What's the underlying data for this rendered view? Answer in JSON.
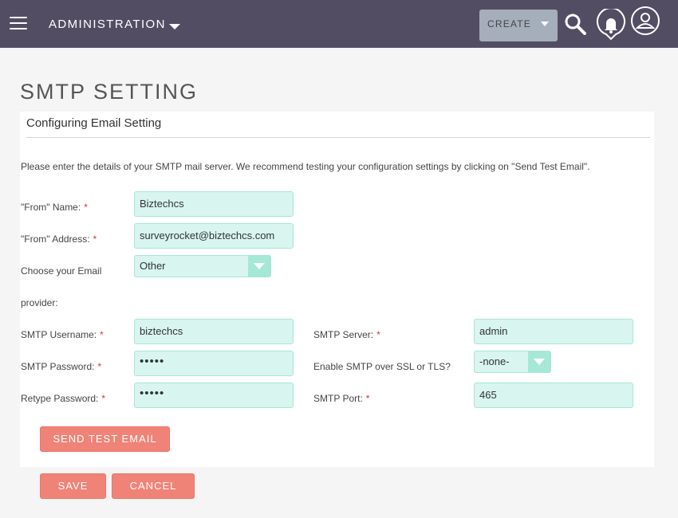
{
  "topbar": {
    "menu_label": "ADMINISTRATION",
    "create_label": "CREATE",
    "icons": [
      "menu-icon",
      "chevron-down-icon",
      "search-icon",
      "bell-icon",
      "user-icon"
    ],
    "colors": {
      "bar": "#534d64",
      "create_button": "#a5aebb"
    }
  },
  "page": {
    "title": "SMTP SETTING",
    "panel_title": "Configuring Email Setting",
    "intro": "Please enter the details of your SMTP mail server. We recommend testing your configuration settings by clicking on \"Send Test Email\"."
  },
  "form": {
    "from_name": {
      "label": "\"From\" Name:",
      "value": "Biztechcs",
      "required": "*"
    },
    "from_address": {
      "label": "\"From\" Address:",
      "value": "surveyrocket@biztechcs.com",
      "required": "*"
    },
    "provider": {
      "label_line1": "Choose your Email",
      "label_line2": "provider:",
      "value": "Other"
    },
    "smtp_username": {
      "label": "SMTP Username:",
      "value": "biztechcs",
      "required": "*"
    },
    "smtp_password": {
      "label": "SMTP Password:",
      "value": "•••••",
      "required": "*"
    },
    "retype_password": {
      "label": "Retype Password:",
      "value": "•••••",
      "required": "*"
    },
    "smtp_server": {
      "label": "SMTP Server:",
      "value": "admin",
      "required": "*"
    },
    "ssl_tls": {
      "label": "Enable SMTP over SSL or TLS?",
      "value": "-none-"
    },
    "smtp_port": {
      "label": "SMTP Port:",
      "value": "465",
      "required": "*"
    }
  },
  "buttons": {
    "send_test": "SEND TEST EMAIL",
    "save": "SAVE",
    "cancel": "CANCEL"
  },
  "colors": {
    "field_bg": "#d8f5ef",
    "field_border": "#a5e8d6",
    "button": "#f08377",
    "required": "#e0322f"
  }
}
